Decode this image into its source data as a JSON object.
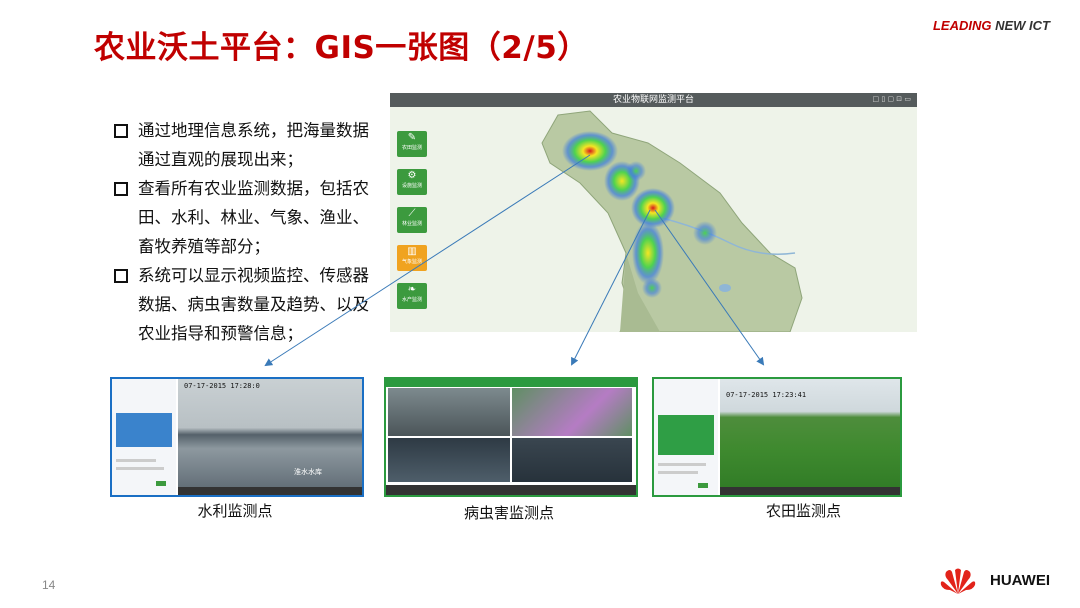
{
  "slide": {
    "title": "农业沃土平台：GIS一张图（2/5）",
    "page_number": "14"
  },
  "brand": {
    "leading": "LEADING",
    "new_ict": "NEW ICT",
    "company": "HUAWEI",
    "colors": {
      "red": "#c00000",
      "dark": "#333333"
    }
  },
  "bullets": [
    "通过地理信息系统，把海量数据通过直观的展现出来；",
    "查看所有农业监测数据，包括农田、水利、林业、气象、渔业、畜牧养殖等部分；",
    "系统可以显示视频监控、传感器数据、病虫害数量及趋势、以及农业指导和预警信息；"
  ],
  "map": {
    "window_title": "农业物联网监测平台",
    "toolbar_text": "□ ▯ ▢ ⊡ ▭",
    "side_buttons": [
      {
        "icon": "leaf-icon",
        "label": "农田监测",
        "color": "#3c9a3e"
      },
      {
        "icon": "tractor-icon",
        "label": "设施监测",
        "color": "#3c9a3e"
      },
      {
        "icon": "branch-icon",
        "label": "林业监测",
        "color": "#3c9a3e"
      },
      {
        "icon": "chart-icon",
        "label": "气象监测",
        "color": "#f0a320"
      },
      {
        "icon": "fish-icon",
        "label": "水产监测",
        "color": "#3c9a3e"
      }
    ]
  },
  "panels": [
    {
      "caption": "水利监测点",
      "timestamp": "07-17-2015 17:28:0",
      "watermark": "淮水水库"
    },
    {
      "caption": "病虫害监测点"
    },
    {
      "caption": "农田监测点",
      "timestamp": "07-17-2015 17:23:41"
    }
  ]
}
